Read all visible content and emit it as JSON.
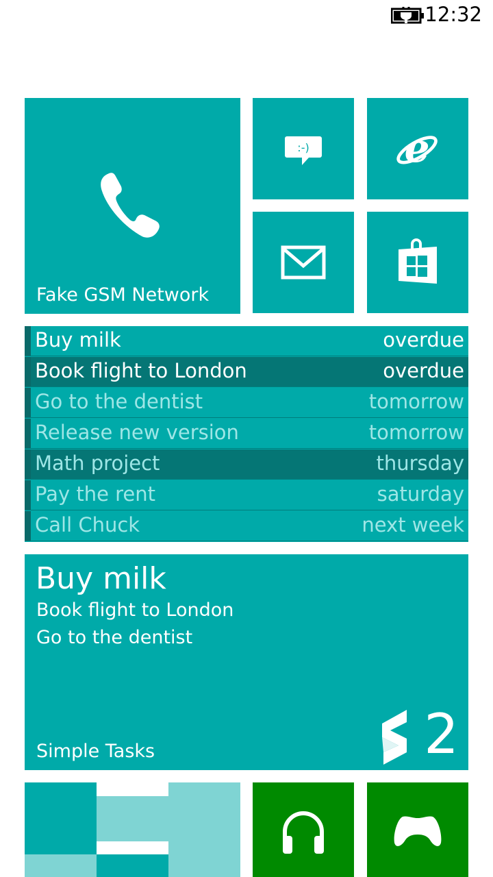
{
  "status": {
    "time": "12:32"
  },
  "phone_tile": {
    "label": "Fake GSM Network"
  },
  "messaging_tile": {
    "emoticon": ":-)"
  },
  "tasks_list": [
    {
      "title": "Buy milk",
      "due": "overdue",
      "style": "white"
    },
    {
      "title": "Book flight to London",
      "due": "overdue",
      "style": "dark-white"
    },
    {
      "title": "Go to the dentist",
      "due": "tomorrow",
      "style": "faded"
    },
    {
      "title": "Release new version",
      "due": "tomorrow",
      "style": "faded"
    },
    {
      "title": "Math project",
      "due": "thursday",
      "style": "dark-faded"
    },
    {
      "title": "Pay the rent",
      "due": "saturday",
      "style": "faded"
    },
    {
      "title": "Call Chuck",
      "due": "next week",
      "style": "faded"
    }
  ],
  "simple_tasks_tile": {
    "first": "Buy milk",
    "second": "Book flight to London",
    "third": "Go to the dentist",
    "label": "Simple Tasks",
    "count": "2"
  },
  "colors": {
    "accent": "#00aaa9",
    "accent_dark": "#057675",
    "faded_text": "#9ee6e6",
    "xbox_green": "#008a00"
  },
  "icons": [
    "battery-charging-icon",
    "phone-icon",
    "messaging-icon",
    "internet-explorer-icon",
    "mail-icon",
    "store-icon",
    "simple-tasks-logo-icon",
    "headphones-icon",
    "gamepad-icon"
  ]
}
